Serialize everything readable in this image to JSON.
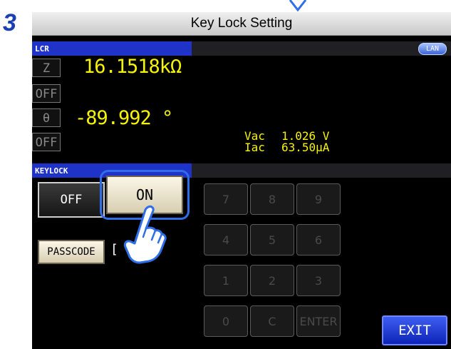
{
  "step": {
    "number": "3"
  },
  "title": "Key Lock Setting",
  "header": {
    "tab": "LCR",
    "lan_badge": "LAN"
  },
  "params": [
    {
      "label": "Z",
      "state": "OFF",
      "value": "16.1518kΩ"
    },
    {
      "label": "θ",
      "state": "OFF",
      "value": "-89.992 °"
    }
  ],
  "monitor": {
    "vac_label": "Vac",
    "vac_value": "1.026 V",
    "iac_label": "Iac",
    "iac_value": "63.50μA"
  },
  "keylock": {
    "section_label": "KEYLOCK",
    "off_label": "OFF",
    "on_label": "ON",
    "passcode_label": "PASSCODE",
    "passcode_value": "[ 0]"
  },
  "keypad": [
    "7",
    "8",
    "9",
    "4",
    "5",
    "6",
    "1",
    "2",
    "3",
    "0",
    "C",
    "ENTER"
  ],
  "exit_label": "EXIT",
  "colors": {
    "accent": "#1f33c8",
    "value": "#f8f400",
    "highlight": "#2f6ee8"
  }
}
